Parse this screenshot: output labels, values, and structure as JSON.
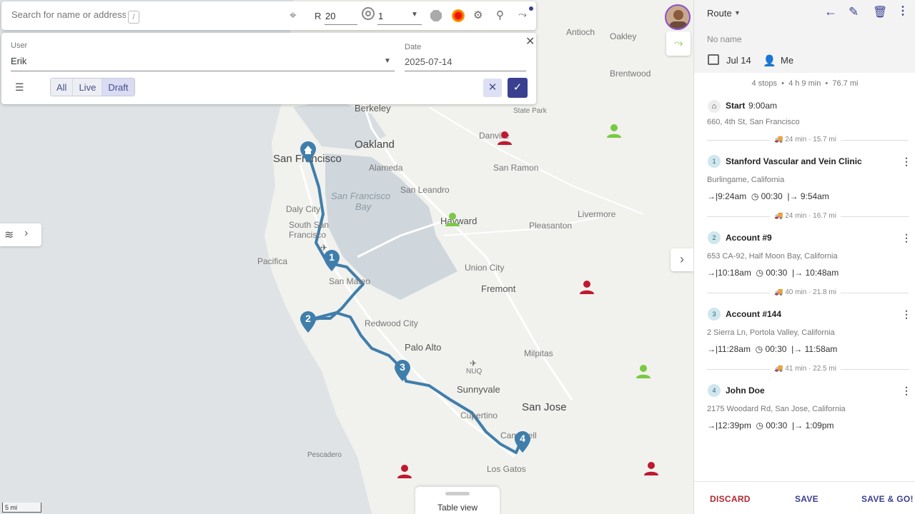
{
  "search": {
    "placeholder": "Search for name or address",
    "shortcut": "/"
  },
  "toolbar": {
    "radius_label": "R",
    "radius_value": "20",
    "count_value": "1"
  },
  "filter": {
    "user_label": "User",
    "user_value": "Erik",
    "date_label": "Date",
    "date_value": "2025-07-14",
    "segments": [
      "All",
      "Live",
      "Draft"
    ],
    "active_segment": "Draft"
  },
  "map": {
    "cities": [
      "San Francisco",
      "Oakland",
      "Berkeley",
      "Alameda",
      "San Ramon",
      "Daly City",
      "South San Francisco",
      "San Leandro",
      "Hayward",
      "Pleasanton",
      "Livermore",
      "Antioch",
      "Oakley",
      "Brentwood",
      "Pacifica",
      "San Mateo",
      "Union City",
      "Fremont",
      "Redwood City",
      "Palo Alto",
      "Milpitas",
      "Sunnyvale",
      "San Jose",
      "Cupertino",
      "Campbell",
      "Los Gatos",
      "Pescadero",
      "State Park",
      "Danville"
    ],
    "water": [
      "San Francisco",
      "Bay"
    ],
    "scale": "5 mi",
    "table_view_label": "Table view",
    "airport_label": "NUQ"
  },
  "route": {
    "title": "Route",
    "name": "No name",
    "date": "Jul 14",
    "driver": "Me",
    "summary": "4 stops  •  4 h 9 min  •  76.7 mi",
    "start": {
      "label": "Start",
      "time": "9:00am",
      "address": "660, 4th St, San Francisco"
    },
    "legs": [
      "24 min · 15.7 mi",
      "24 min · 16.7 mi",
      "40 min · 21.8 mi",
      "41 min · 22.5 mi"
    ],
    "stops": [
      {
        "num": "1",
        "name": "Stanford Vascular and Vein Clinic",
        "address": "Burlingame, California",
        "arrive": "9:24am",
        "duration": "00:30",
        "depart": "9:54am"
      },
      {
        "num": "2",
        "name": "Account #9",
        "address": "653 CA-92, Half Moon Bay, California",
        "arrive": "10:18am",
        "duration": "00:30",
        "depart": "10:48am"
      },
      {
        "num": "3",
        "name": "Account #144",
        "address": "2 Sierra Ln, Portola Valley, California",
        "arrive": "11:28am",
        "duration": "00:30",
        "depart": "11:58am"
      },
      {
        "num": "4",
        "name": "John Doe",
        "address": "2175 Woodard Rd, San Jose, California",
        "arrive": "12:39pm",
        "duration": "00:30",
        "depart": "1:09pm"
      }
    ],
    "actions": {
      "discard": "DISCARD",
      "save": "SAVE",
      "save_go": "SAVE & GO!"
    }
  },
  "colors": {
    "route_line": "#3f7eab",
    "accent": "#3a3f8f",
    "red_marker": "#c0182f",
    "green_marker": "#7ac943",
    "discard": "#b3262e"
  }
}
